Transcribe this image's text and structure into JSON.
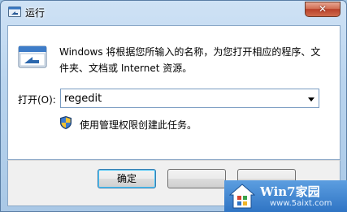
{
  "window": {
    "title": "运行",
    "close_glyph": "✕"
  },
  "description": "Windows 将根据您所输入的名称，为您打开相应的程序、文件夹、文档或 Internet 资源。",
  "open_label": "打开(O):",
  "command_input": {
    "value": "regedit"
  },
  "admin_notice": "使用管理权限创建此任务。",
  "buttons": {
    "ok": "确定"
  },
  "watermark": {
    "title": "Win7家园",
    "url": "www.5aixt.com"
  },
  "icons": {
    "title": "run-icon",
    "dialog": "run-program-icon",
    "shield": "uac-shield-icon",
    "dropdown": "chevron-down-icon",
    "logo": "house-logo-icon"
  },
  "colors": {
    "accent": "#3c7fb1",
    "close": "#c9533a",
    "watermark": "#2f74c4"
  }
}
